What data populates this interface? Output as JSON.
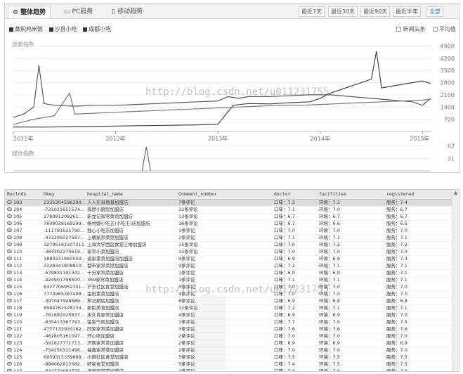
{
  "tabs": [
    {
      "label": "整体趋势",
      "icon": "gear-icon",
      "active": true
    },
    {
      "label": "PC趋势",
      "icon": "monitor-icon",
      "active": false
    },
    {
      "label": "移动趋势",
      "icon": "phone-icon",
      "active": false
    }
  ],
  "ranges": [
    {
      "label": "最近7天",
      "active": false
    },
    {
      "label": "最近30天",
      "active": false
    },
    {
      "label": "最近90天",
      "active": false
    },
    {
      "label": "最近半年",
      "active": false
    },
    {
      "label": "全部",
      "active": true
    }
  ],
  "legend": [
    "黄焖鸡米饭",
    "沙县小吃",
    "成都小吃"
  ],
  "options": [
    "新闻头条",
    "平均值"
  ],
  "search_index_label": "搜索指数",
  "media_index_label": "媒体指数",
  "watermark": "http://blog.csdn.net/u011231755",
  "chart_data": {
    "type": "line",
    "title": "",
    "x_labels": [
      "2011年",
      "2012年",
      "2013年",
      "2014年",
      "2015年"
    ],
    "y_ticks": [
      700,
      1400,
      2100,
      2800,
      3500,
      4200,
      4900
    ],
    "ylim": [
      0,
      5000
    ],
    "xlim": [
      2011.0,
      2015.08
    ],
    "series": [
      {
        "name": "黄焖鸡米饭",
        "color": "#444444",
        "points": [
          [
            2011.0,
            260
          ],
          [
            2011.3,
            250
          ],
          [
            2011.6,
            280
          ],
          [
            2011.9,
            300
          ],
          [
            2012.2,
            330
          ],
          [
            2012.5,
            350
          ],
          [
            2012.8,
            380
          ],
          [
            2013.0,
            420
          ],
          [
            2013.15,
            1500
          ],
          [
            2013.3,
            1600
          ],
          [
            2013.5,
            1580
          ],
          [
            2013.7,
            1650
          ],
          [
            2013.9,
            1700
          ],
          [
            2014.0,
            1900
          ],
          [
            2014.1,
            2200
          ],
          [
            2014.2,
            2400
          ],
          [
            2014.3,
            2600
          ],
          [
            2014.4,
            2800
          ],
          [
            2014.5,
            3000
          ],
          [
            2014.55,
            4600
          ],
          [
            2014.6,
            2500
          ],
          [
            2014.7,
            2600
          ],
          [
            2014.8,
            2700
          ],
          [
            2014.9,
            2800
          ],
          [
            2015.0,
            2900
          ],
          [
            2015.08,
            2750
          ]
        ]
      },
      {
        "name": "沙县小吃",
        "color": "#5a5a5a",
        "points": [
          [
            2011.0,
            800
          ],
          [
            2011.1,
            1000
          ],
          [
            2011.2,
            1400
          ],
          [
            2011.25,
            3800
          ],
          [
            2011.3,
            1600
          ],
          [
            2011.4,
            1500
          ],
          [
            2011.6,
            1450
          ],
          [
            2011.8,
            1500
          ],
          [
            2012.0,
            1500
          ],
          [
            2012.2,
            1550
          ],
          [
            2012.4,
            1600
          ],
          [
            2012.6,
            1650
          ],
          [
            2012.8,
            1700
          ],
          [
            2013.0,
            1750
          ],
          [
            2013.1,
            2000
          ],
          [
            2013.2,
            1900
          ],
          [
            2013.3,
            2000
          ],
          [
            2013.5,
            2000
          ],
          [
            2013.7,
            2050
          ],
          [
            2013.9,
            2100
          ],
          [
            2014.1,
            2100
          ],
          [
            2014.3,
            2000
          ],
          [
            2014.5,
            1900
          ],
          [
            2014.7,
            1800
          ],
          [
            2014.9,
            1700
          ],
          [
            2015.0,
            1500
          ],
          [
            2015.08,
            1900
          ]
        ]
      },
      {
        "name": "成都小吃",
        "color": "#777777",
        "points": [
          [
            2011.0,
            400
          ],
          [
            2011.2,
            700
          ],
          [
            2011.4,
            900
          ],
          [
            2011.55,
            2200
          ],
          [
            2011.6,
            1000
          ],
          [
            2011.8,
            1050
          ],
          [
            2012.0,
            1100
          ],
          [
            2012.2,
            1150
          ],
          [
            2012.4,
            1200
          ],
          [
            2012.6,
            1250
          ],
          [
            2012.8,
            1300
          ],
          [
            2013.0,
            1350
          ],
          [
            2013.2,
            1400
          ],
          [
            2013.4,
            1450
          ],
          [
            2013.6,
            1500
          ],
          [
            2013.8,
            1500
          ],
          [
            2014.0,
            1550
          ],
          [
            2014.2,
            1600
          ],
          [
            2014.4,
            1650
          ],
          [
            2014.6,
            1700
          ],
          [
            2014.8,
            1750
          ],
          [
            2015.0,
            1800
          ],
          [
            2015.08,
            1850
          ]
        ]
      }
    ],
    "media_y_ticks": [
      31,
      62
    ]
  },
  "table": {
    "columns": [
      "Reclndx",
      "hkey",
      "hospital_name",
      "Comment_number",
      "doctor",
      "facilities",
      "registered"
    ],
    "rows": [
      [
        "103",
        "23353045963​00...",
        "人人乐肯德基加盟店",
        "7条评论",
        "口味：7.3",
        "环境：7.3",
        "服务：7.4"
      ],
      [
        "104",
        "-7310216515​74...",
        "海彦小厨房加盟店",
        "22条评论",
        "口味：7.1",
        "环境：7.0",
        "服务：6.7"
      ],
      [
        "105",
        "27808120826​1...",
        "新龙记家常菜馆加盟店",
        "13条评论",
        "口味：6.7",
        "环境：6.7",
        "服务：6.7"
      ],
      [
        "106",
        "78080381692​99...",
        "杨村嫂小吃五)小吃王)店加盟店",
        "16条评论",
        "口味：6.7",
        "环境：6.6",
        "服务：6.5"
      ],
      [
        "107",
        "-1117816257​90...",
        "独心小吃店加盟店",
        "1条评论",
        "口味：7.0",
        "环境：7.0",
        "服务：7.0"
      ],
      [
        "108",
        "-4722950275​87...",
        "上朝家常菜馆加盟店",
        "2条评论",
        "口味：7.1",
        "环境：7.1",
        "服务：7.1"
      ],
      [
        "109",
        "32795162207​211...",
        "上海大学西区食堂三楼加盟店",
        "15条评论",
        "口味：7.0",
        "环境：7.2",
        "服务：7.2"
      ],
      [
        "110",
        "-3843022795​19...",
        "家常小菜加盟店",
        "12条评论",
        "口味：7.0",
        "环境：7.0",
        "服务：7.0"
      ],
      [
        "111",
        "18802319605​50...",
        "道家素菜加盟店加盟店",
        "9条评论",
        "口味：6.9",
        "环境：6.9",
        "服务：7.3"
      ],
      [
        "112",
        "31283418088​10...",
        "都市家常菜馆加盟店",
        "9条评论",
        "口味：7.2",
        "环境：7.1",
        "服务：7.1"
      ],
      [
        "113",
        "-5798311913​42...",
        "十分家常菜加盟店",
        "1条评论",
        "口味：6.9",
        "环境：6.9",
        "服务：7.1"
      ],
      [
        "114",
        "-4249017965​00...",
        "369家常菜加盟店",
        "1条评论",
        "口味：7.1",
        "环境：7.1",
        "服务：7.1"
      ],
      [
        "115",
        "63277069521​51...",
        "沪东社区食堂加盟店",
        "3条评论",
        "口味：7.0",
        "环境：7.0",
        "服务：7.0"
      ],
      [
        "116",
        "77749653874​08...",
        "金阳素菜加盟店",
        "4条评论",
        "口味：7.0",
        "环境：7.0",
        "服务：7.0"
      ],
      [
        "117",
        "-3970479465​89...",
        "和记厨房加盟店",
        "6条评论",
        "口味：6.9",
        "环境：6.8",
        "服务：6.8"
      ],
      [
        "118",
        "85847625281​34...",
        "新民美食加盟店",
        "12条评论",
        "口味：7.2",
        "环境：7.1",
        "服务：7.1"
      ],
      [
        "119",
        "-7618820258​37...",
        "永久肯家常加盟店",
        "4条评论",
        "口味：6.9",
        "环境：6.9",
        "服务：7.0"
      ],
      [
        "120",
        "-8354133677​93...",
        "金家气肉加盟店",
        "1条评论",
        "口味：7.7",
        "环境：7.5",
        "服务：7.5"
      ],
      [
        "121",
        "47771329201​62...",
        "同家家常菜加盟店",
        "3条评论",
        "口味：7.6",
        "环境：7.6",
        "服务：7.6"
      ],
      [
        "122",
        "-4628051610​97...",
        "开心吃加盟店",
        "2条评论",
        "口味：7.0",
        "环境：7.0",
        "服务：7.0"
      ],
      [
        "123",
        "-5918277717​13...",
        "济南家常菜加盟店",
        "2条评论",
        "口味：6.9",
        "环境：6.9",
        "服务：6.9"
      ],
      [
        "124",
        "-7542563114​96...",
        "福鑫家常菜加盟店",
        "2条评论",
        "口味：7.0",
        "环境：7.0",
        "服务：7.0"
      ],
      [
        "125",
        "69593153598​89...",
        "小麻社区食堂加盟店",
        "5条评论",
        "口味：7.5",
        "环境：7.5",
        "服务：7.5"
      ],
      [
        "126",
        "-8840628126​82...",
        "好家食堂加盟店",
        "5条评论",
        "口味：7.4",
        "环境：7.5",
        "服务：7.5"
      ],
      [
        "127",
        "-6347706837​75...",
        "清泉家常菜加盟店",
        "3条评论",
        "口味：7.0",
        "环境：7.0",
        "服务：7.0"
      ]
    ]
  }
}
